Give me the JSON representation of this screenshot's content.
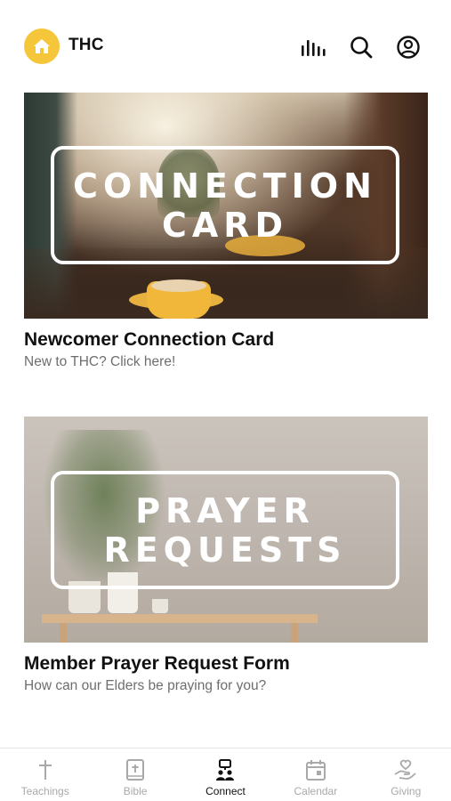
{
  "header": {
    "brand": "THC",
    "icons": [
      "church-logo-icon",
      "audio-bars-icon",
      "search-icon",
      "account-icon"
    ]
  },
  "cards": [
    {
      "image_text": [
        "CONNECTION",
        "CARD"
      ],
      "title": "Newcomer Connection Card",
      "subtitle": "New to THC? Click here!"
    },
    {
      "image_text": [
        "PRAYER",
        "REQUESTS"
      ],
      "title": "Member Prayer Request Form",
      "subtitle": "How can our Elders be praying for you?"
    }
  ],
  "tabbar": {
    "active": "Connect",
    "tabs": [
      {
        "label": "Teachings",
        "icon": "cross-icon"
      },
      {
        "label": "Bible",
        "icon": "bible-icon"
      },
      {
        "label": "Connect",
        "icon": "connect-icon"
      },
      {
        "label": "Calendar",
        "icon": "calendar-icon"
      },
      {
        "label": "Giving",
        "icon": "giving-hand-icon"
      }
    ]
  },
  "colors": {
    "brand_yellow": "#f5c63a",
    "text_primary": "#111111",
    "text_secondary": "#6e6e6e",
    "tab_inactive": "#a9a9a9"
  }
}
